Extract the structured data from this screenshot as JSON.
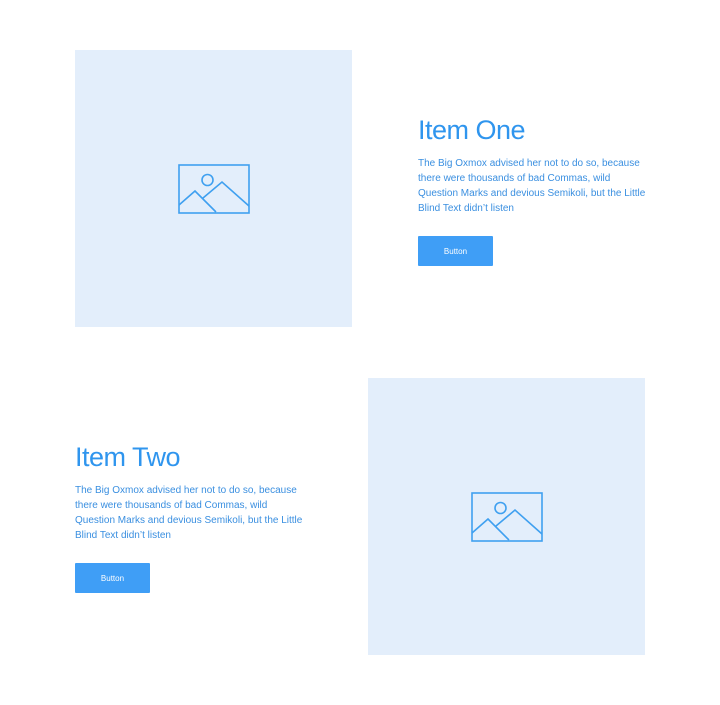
{
  "colors": {
    "accent": "#3f9ef6",
    "title_text": "#2f95ee",
    "body_text": "#3a8fe0",
    "placeholder_bg": "#e3eefb",
    "placeholder_icon": "#3fa0f0"
  },
  "items": [
    {
      "title": "Item One",
      "description": "The Big Oxmox advised her not to do so, because there were thousands of bad Commas, wild Question Marks and devious Semikoli, but the Little Blind Text didn’t listen",
      "button_label": "Button",
      "image_icon": "image-placeholder-icon"
    },
    {
      "title": "Item Two",
      "description": "The Big Oxmox advised her not to do so, because there were thousands of bad Commas, wild Question Marks and devious Semikoli, but the Little Blind Text didn’t listen",
      "button_label": "Button",
      "image_icon": "image-placeholder-icon"
    }
  ]
}
